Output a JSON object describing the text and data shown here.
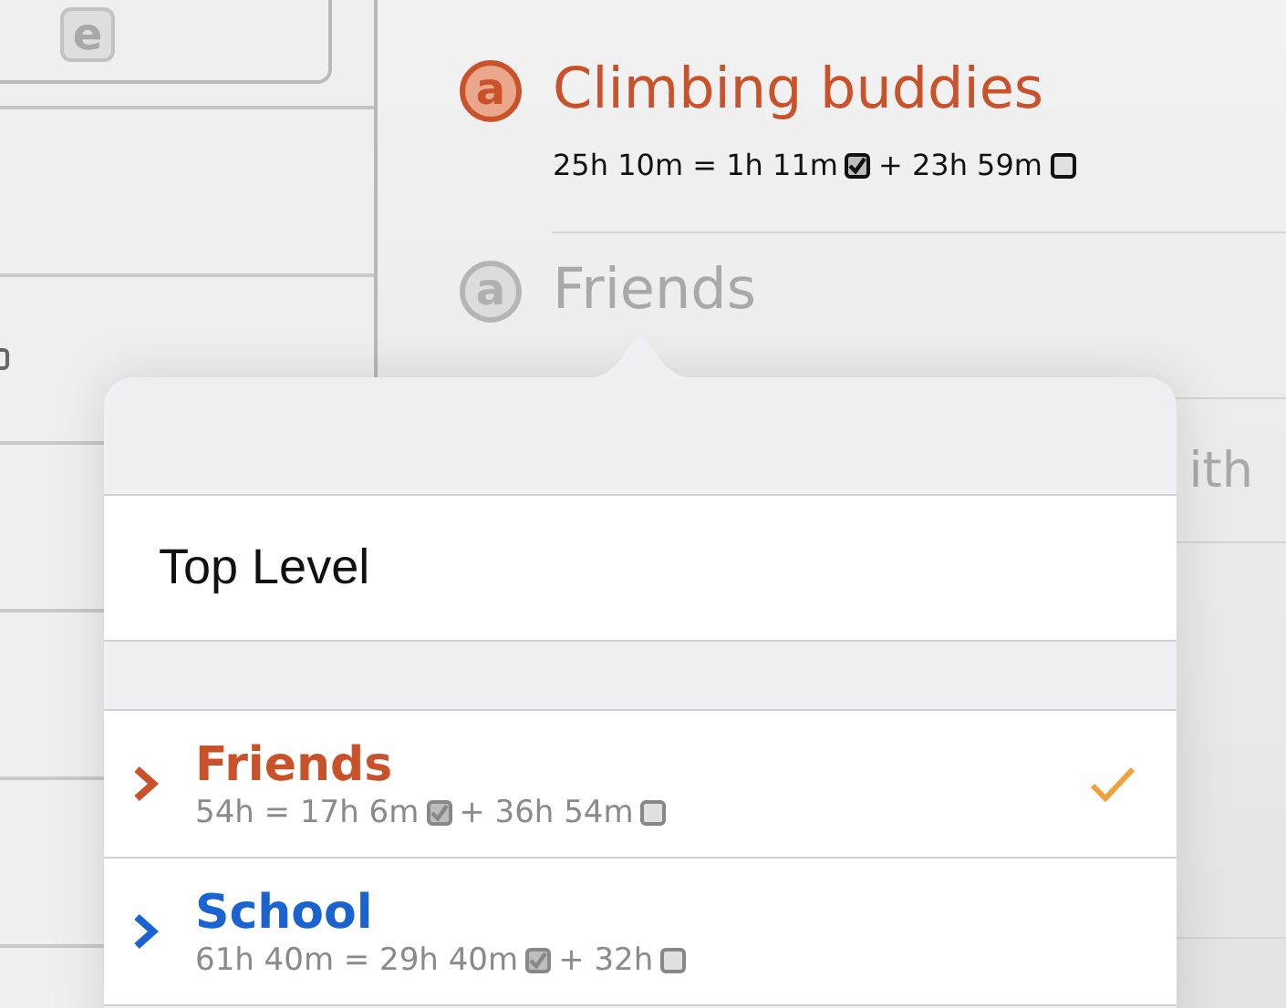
{
  "sidebar": {
    "card_icon_letter": "e"
  },
  "groups": [
    {
      "icon_letter": "a",
      "title": "Climbing buddies",
      "active": true,
      "stats": [
        {
          "kind": "text",
          "text": "25h 10m = 1h 11m"
        },
        {
          "kind": "box",
          "checked": true
        },
        {
          "kind": "text",
          "text": "+ 23h 59m"
        },
        {
          "kind": "box",
          "checked": false
        }
      ]
    },
    {
      "icon_letter": "a",
      "title": "Friends",
      "active": false
    }
  ],
  "partial_text": "ith",
  "popover": {
    "top_level": "Top Level",
    "items": [
      {
        "title": "Friends",
        "color": "#c9522a",
        "selected": true,
        "stats": [
          {
            "kind": "text",
            "text": "54h = 17h 6m"
          },
          {
            "kind": "box",
            "checked": true
          },
          {
            "kind": "text",
            "text": "+ 36h 54m"
          },
          {
            "kind": "box",
            "checked": false
          }
        ]
      },
      {
        "title": "School",
        "color": "#1a63d0",
        "selected": false,
        "stats": [
          {
            "kind": "text",
            "text": "61h 40m = 29h 40m"
          },
          {
            "kind": "box",
            "checked": true
          },
          {
            "kind": "text",
            "text": "+ 32h"
          },
          {
            "kind": "box",
            "checked": false
          }
        ]
      }
    ]
  }
}
